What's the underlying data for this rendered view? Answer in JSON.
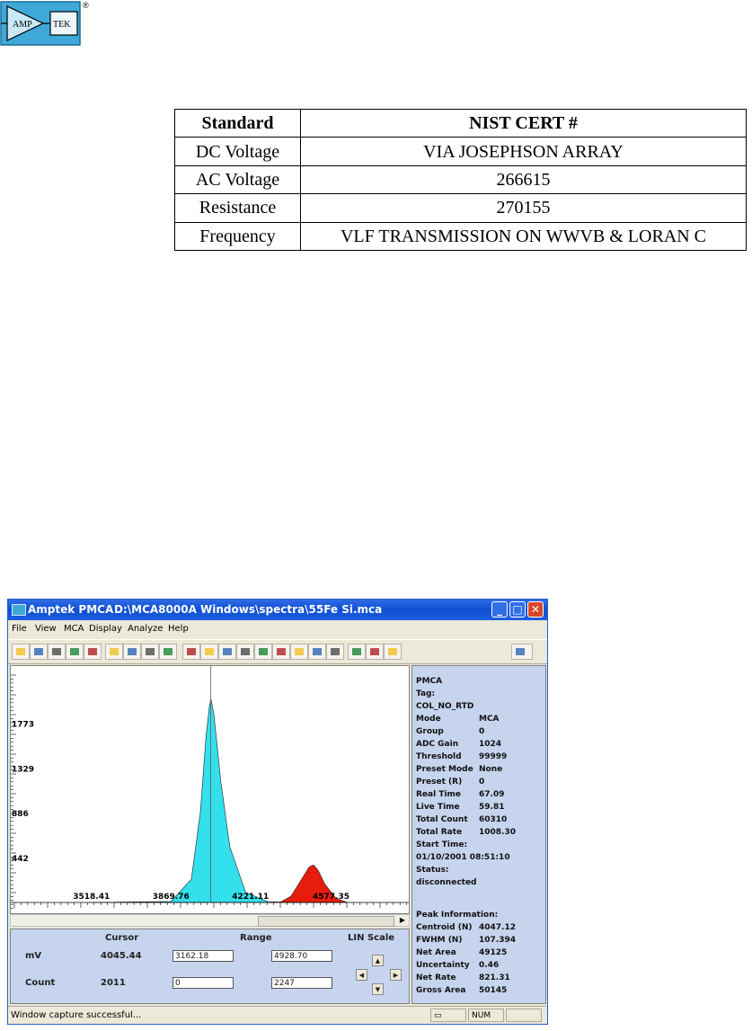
{
  "logo": {
    "left_text": "AMP",
    "right_text": "TEK",
    "registered_mark": "®"
  },
  "nist_table": {
    "headers": [
      "Standard",
      "NIST CERT #"
    ],
    "rows": [
      [
        "DC Voltage",
        "VIA JOSEPHSON ARRAY"
      ],
      [
        "AC Voltage",
        "266615"
      ],
      [
        "Resistance",
        "270155"
      ],
      [
        "Frequency",
        "VLF TRANSMISSION ON WWVB & LORAN C"
      ]
    ]
  },
  "window": {
    "app_name": "Amptek PMCA",
    "file_path": "D:\\MCA8000A Windows\\spectra\\55Fe Si.mca",
    "menu": [
      "File",
      "View",
      "MCA",
      "Display",
      "Analyze",
      "Help"
    ],
    "toolbar_icons": [
      "open-icon",
      "save-icon",
      "print-icon",
      "copy-icon",
      "properties-icon",
      "roi-icon",
      "calibrate-icon",
      "acquire-icon",
      "settings-icon",
      "color-icon",
      "full-view-icon",
      "expand-horizontal-icon",
      "expand-vertical-icon",
      "zoom-box-icon",
      "bar-plot-icon",
      "line-plot-icon",
      "auto-scale-icon",
      "point-plot-icon",
      "log-plot-icon",
      "peak-search-icon",
      "energy-icon",
      "fp-icon"
    ],
    "status_text": "Window capture successful...",
    "status_num": "NUM"
  },
  "plot": {
    "y_tick_labels": [
      "1773",
      "1329",
      "886",
      "442"
    ],
    "x_tick_labels": [
      "3518.41",
      "3869.76",
      "4221.11",
      "4577.35"
    ],
    "colors": {
      "main_peak": "#33e0ec",
      "second_peak": "#e81c0c",
      "cursor": "#606060"
    }
  },
  "chart_data": {
    "type": "area",
    "series": [
      {
        "x": [
          3518.41,
          3870,
          3960,
          4000,
          4025,
          4040,
          4047,
          4060,
          4090,
          4130,
          4200,
          4300,
          4400,
          4500,
          4577.35
        ],
        "values": [
          0,
          10,
          230,
          900,
          1650,
          1940,
          2010,
          1850,
          1200,
          550,
          100,
          6,
          3,
          0,
          0
        ]
      },
      {
        "x": [
          4350,
          4400,
          4450,
          4480,
          4500,
          4520,
          4550,
          4600,
          4650
        ],
        "values": [
          0,
          60,
          240,
          350,
          370,
          320,
          180,
          40,
          0
        ]
      }
    ],
    "cursor_x": 4045.44
  },
  "bottom_panel": {
    "cursor_header": "Cursor",
    "range_header": "Range",
    "scale_header": "LIN Scale",
    "mv_label": "mV",
    "count_label": "Count",
    "cursor_mv": "4045.44",
    "cursor_count": "2011",
    "range_mv_low": "3162.18",
    "range_mv_high": "4928.70",
    "range_count_low": "0",
    "range_count_high": "2247"
  },
  "info_panel": {
    "title": "PMCA",
    "tag_label": "Tag:",
    "tag_value": "COL_NO_RTD",
    "rows": [
      [
        "Mode",
        "MCA"
      ],
      [
        "Group",
        "0"
      ],
      [
        "ADC Gain",
        "1024"
      ],
      [
        "Threshold",
        "99999"
      ],
      [
        "Preset Mode",
        "None"
      ],
      [
        "Preset (R)",
        "0"
      ],
      [
        "Real Time",
        "67.09"
      ],
      [
        "Live Time",
        "59.81"
      ],
      [
        "Total Count",
        "60310"
      ],
      [
        "Total Rate",
        "1008.30"
      ]
    ],
    "start_time_label": "Start Time:",
    "start_time_value": "01/10/2001 08:51:10",
    "status_label": "Status:",
    "status_value": "disconnected",
    "peak_info_label": "Peak Information:",
    "peak_rows": [
      [
        "Centroid (N)",
        "4047.12"
      ],
      [
        "FWHM (N)",
        "107.394"
      ],
      [
        "Net Area",
        "49125"
      ],
      [
        "Uncertainty",
        "0.46"
      ],
      [
        "Net Rate",
        "821.31"
      ],
      [
        "Gross Area",
        "50145"
      ]
    ]
  }
}
